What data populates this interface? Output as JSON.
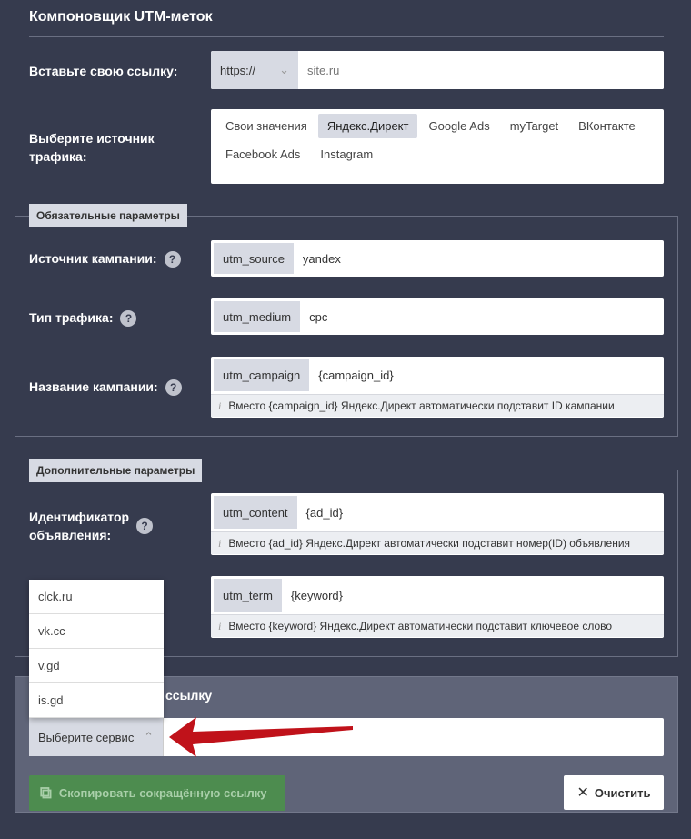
{
  "title": "Компоновщик UTM-меток",
  "url": {
    "label": "Вставьте свою ссылку:",
    "protocol": "https://",
    "placeholder": "site.ru"
  },
  "source": {
    "label": "Выберите источник трафика:",
    "options": [
      "Свои значения",
      "Яндекс.Директ",
      "Google Ads",
      "myTarget",
      "ВКонтакте",
      "Facebook Ads",
      "Instagram"
    ],
    "selected": "Яндекс.Директ"
  },
  "required": {
    "legend": "Обязательные параметры",
    "fields": [
      {
        "label": "Источник кампании:",
        "param": "utm_source",
        "value": "yandex"
      },
      {
        "label": "Тип трафика:",
        "param": "utm_medium",
        "value": "cpc"
      },
      {
        "label": "Название кампании:",
        "param": "utm_campaign",
        "value": "{campaign_id}",
        "hint": "Вместо {campaign_id} Яндекс.Директ автоматически подставит ID кампании"
      }
    ]
  },
  "optional": {
    "legend": "Дополнительные параметры",
    "fields": [
      {
        "label": "Идентификатор объявления:",
        "param": "utm_content",
        "value": "{ad_id}",
        "hint": "Вместо {ad_id} Яндекс.Директ автоматически подставит номер(ID) объявления"
      },
      {
        "param": "utm_term",
        "value": "{keyword}",
        "hint": "Вместо {keyword} Яндекс.Директ автоматически подставит ключевое слово"
      }
    ]
  },
  "shorten": {
    "title_visible": "ссылку",
    "select_label": "Выберите сервис",
    "services": [
      "clck.ru",
      "vk.cc",
      "v.gd",
      "is.gd"
    ],
    "copy_label": "Скопировать сокращённую ссылку",
    "clear_label": "Очистить"
  },
  "help_icon": "?",
  "colors": {
    "bg": "#363b4e",
    "panel": "#5f6478",
    "green": "#4d8c4f",
    "arrow": "#c0121a"
  }
}
